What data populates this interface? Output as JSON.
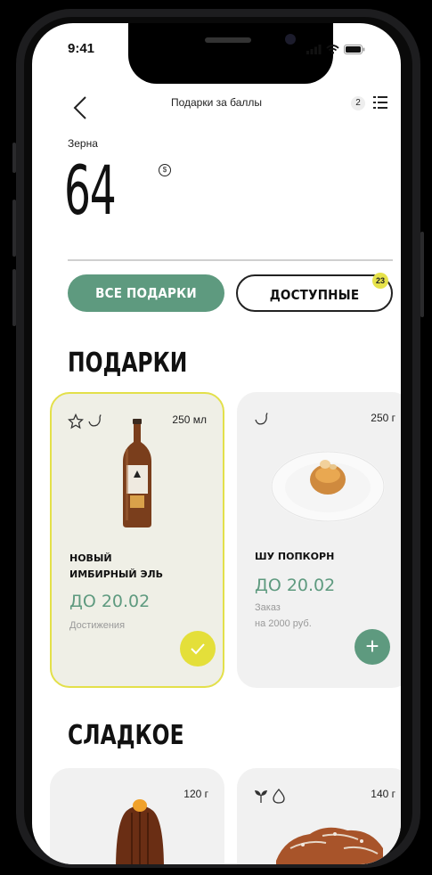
{
  "status_bar": {
    "time": "9:41"
  },
  "header": {
    "title": "Подарки за баллы",
    "list_count": "2"
  },
  "balance": {
    "label": "Зерна",
    "value": "64",
    "currency_symbol": "$"
  },
  "tabs": [
    {
      "label": "ВСЕ ПОДАРКИ",
      "active": true
    },
    {
      "label": "ДОСТУПНЫЕ",
      "badge": "23"
    }
  ],
  "sections": [
    {
      "title": "ПОДАРКИ",
      "cards": [
        {
          "size": "250 мл",
          "name_line1": "НОВЫЙ",
          "name_line2": "ИМБИРНЫЙ ЭЛЬ",
          "date": "ДО 20.02",
          "note": "Достижения",
          "selected": true,
          "icons": [
            "star-icon",
            "pepper-icon"
          ]
        },
        {
          "size": "250 г",
          "name_line1": "ШУ ПОПКОРН",
          "date": "ДО 20.02",
          "note_line1": "Заказ",
          "note_line2": "на 2000 руб.",
          "icons": [
            "pepper-icon"
          ]
        }
      ]
    },
    {
      "title": "СЛАДКОЕ",
      "cards": [
        {
          "size": "120 г"
        },
        {
          "size": "140 г",
          "icons": [
            "sprout-icon",
            "drop-icon"
          ]
        }
      ]
    }
  ],
  "colors": {
    "accent": "#5e9a7f",
    "highlight": "#e4df3a",
    "card_bg": "#f1f1f1"
  }
}
